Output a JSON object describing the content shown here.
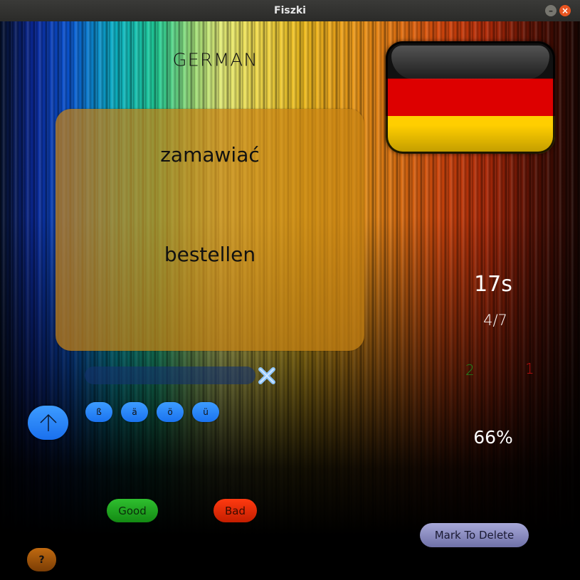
{
  "window": {
    "title": "Fiszki"
  },
  "language": {
    "title": "GERMAN",
    "flag_icon": "german-flag-icon",
    "flag_colors": [
      "#000000",
      "#dd0000",
      "#ffce00"
    ]
  },
  "card": {
    "front": "zamawiać",
    "back": "bestellen"
  },
  "answer": {
    "value": "",
    "placeholder": ""
  },
  "special_chars": [
    "ß",
    "ä",
    "ö",
    "ü"
  ],
  "stats": {
    "timer": "17s",
    "progress": "4/7",
    "good": "2",
    "bad": "1",
    "percent": "66%"
  },
  "buttons": {
    "good": "Good",
    "bad": "Bad",
    "mark_delete": "Mark To Delete",
    "help": "?"
  },
  "colors": {
    "accent_blue": "#1a73f0",
    "good_green": "#1f9f1f",
    "bad_red": "#e02a06",
    "card": "#c8821a"
  }
}
